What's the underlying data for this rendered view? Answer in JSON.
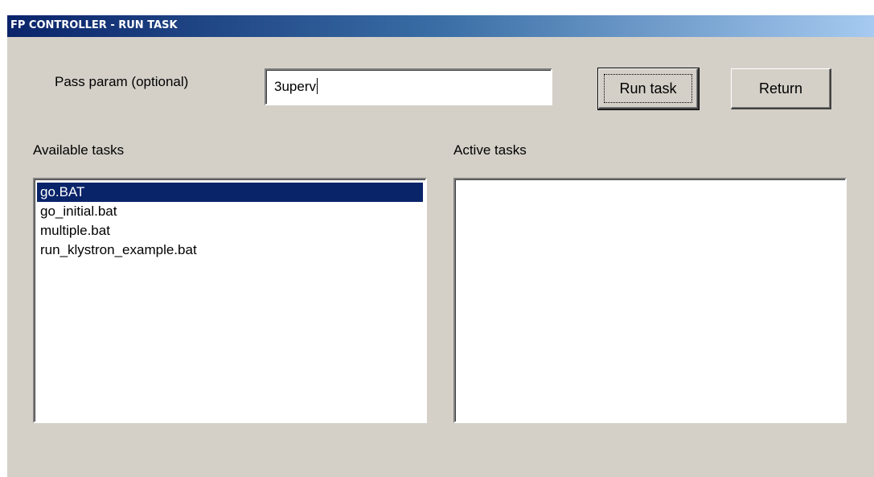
{
  "window": {
    "title": "FP CONTROLLER - RUN TASK"
  },
  "param": {
    "label": "Pass param (optional)",
    "value": "3uperv"
  },
  "buttons": {
    "run_task": "Run task",
    "return": "Return"
  },
  "available_tasks": {
    "label": "Available tasks",
    "selected_index": 0,
    "items": [
      {
        "label": "go.BAT"
      },
      {
        "label": "go_initial.bat"
      },
      {
        "label": "multiple.bat"
      },
      {
        "label": "run_klystron_example.bat"
      }
    ]
  },
  "active_tasks": {
    "label": "Active tasks",
    "items": []
  },
  "colors": {
    "face": "#d4d0c8",
    "title_start": "#0a246a",
    "title_end": "#a6caf0",
    "selection": "#0a246a"
  }
}
